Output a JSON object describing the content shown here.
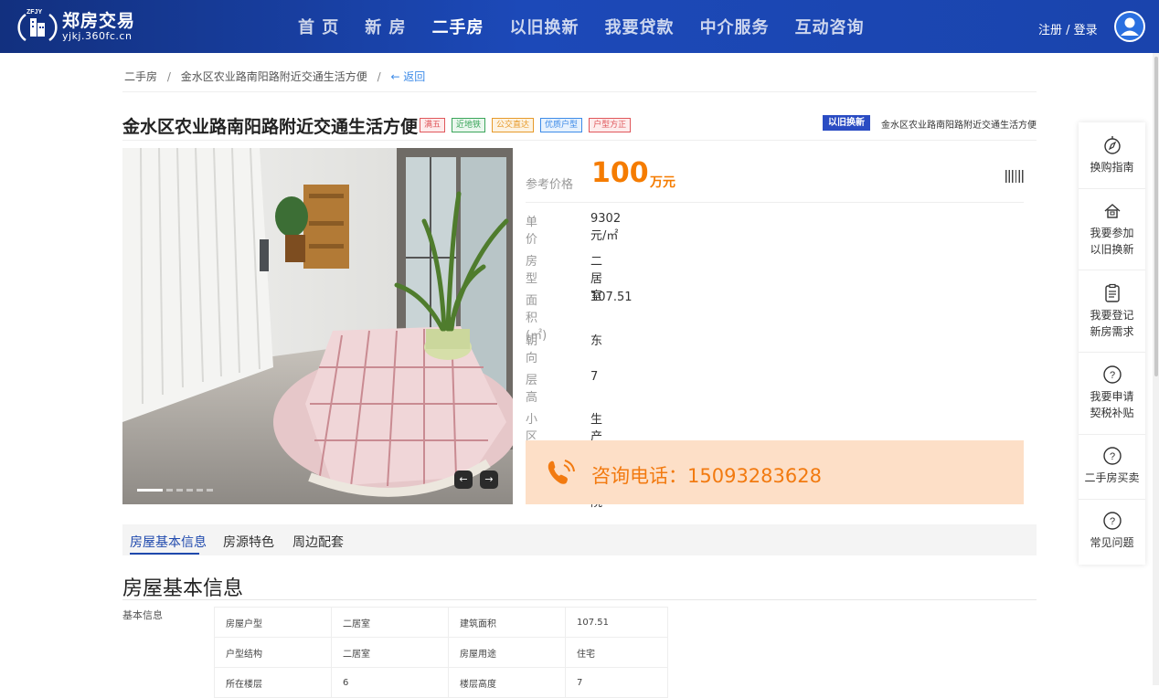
{
  "header": {
    "logo_title": "郑房交易",
    "logo_domain": "yjkj.360fc.cn",
    "logo_letters": "ZFJY",
    "nav": [
      {
        "label": "首 页",
        "active": false
      },
      {
        "label": "新 房",
        "active": false
      },
      {
        "label": "二手房",
        "active": true
      },
      {
        "label": "以旧换新",
        "active": false
      },
      {
        "label": "我要贷款",
        "active": false
      },
      {
        "label": "中介服务",
        "active": false
      },
      {
        "label": "互动咨询",
        "active": false
      }
    ],
    "login": "注册 / 登录",
    "colors": {
      "bar_start": "#12307f",
      "bar_end": "#1a44ad"
    }
  },
  "breadcrumb": {
    "root": "二手房",
    "separator": "/",
    "current": "金水区农业路南阳路附近交通生活方便",
    "back": "← 返回"
  },
  "listing": {
    "title": "金水区农业路南阳路附近交通生活方便",
    "tags": [
      {
        "label": "满五",
        "color": "#e0575b",
        "bg": "#fdecec"
      },
      {
        "label": "近地铁",
        "color": "#3aa55a",
        "bg": "#eaf7ee"
      },
      {
        "label": "公交直达",
        "color": "#e79a2a",
        "bg": "#fdf3e2"
      },
      {
        "label": "优质户型",
        "color": "#3d8be8",
        "bg": "#e8f2fd"
      },
      {
        "label": "户型方正",
        "color": "#e0575b",
        "bg": "#fdecec"
      }
    ],
    "promo_badge": "以旧换新",
    "promo_text": "金水区农业路南阳路附近交通生活方便"
  },
  "gallery": {
    "slide_count": 6,
    "active_slide": 1,
    "prev": "←",
    "next": "→"
  },
  "info": {
    "price_label": "参考价格",
    "price_value": "100",
    "price_unit": "万元",
    "rows": [
      {
        "label": "单价",
        "value": "9302 元/㎡"
      },
      {
        "label": "房型",
        "value": "二居室"
      },
      {
        "label": "面积(㎡)",
        "value": "107.51"
      },
      {
        "label": "朝向",
        "value": "东"
      },
      {
        "label": "层高",
        "value": "7"
      },
      {
        "label": "小区名称",
        "value": "生产路8号院"
      }
    ],
    "phone_text": "咨询电话：15093283628",
    "accent": "#f57c00",
    "phone_bg": "#fddfc7"
  },
  "side": {
    "items": [
      {
        "label": "换购指南",
        "icon": "compass-icon"
      },
      {
        "label": "我要参加以旧换新",
        "line1": "我要参加",
        "line2": "以旧换新",
        "icon": "house-icon"
      },
      {
        "label": "我要登记新房需求",
        "line1": "我要登记",
        "line2": "新房需求",
        "icon": "clipboard-icon"
      },
      {
        "label": "我要申请契税补贴",
        "line1": "我要申请",
        "line2": "契税补贴",
        "icon": "question-icon"
      },
      {
        "label": "二手房买卖",
        "icon": "question-icon"
      },
      {
        "label": "常见问题",
        "icon": "question-icon"
      }
    ]
  },
  "tabs": [
    {
      "label": "房屋基本信息",
      "active": true
    },
    {
      "label": "房源特色",
      "active": false
    },
    {
      "label": "周边配套",
      "active": false
    }
  ],
  "section": {
    "title": "房屋基本信息",
    "basic_label": "基本信息",
    "table": [
      [
        "房屋户型",
        "二居室",
        "建筑面积",
        "107.51"
      ],
      [
        "户型结构",
        "二居室",
        "房屋用途",
        "住宅"
      ],
      [
        "所在楼层",
        "6",
        "楼层高度",
        "7"
      ]
    ]
  }
}
